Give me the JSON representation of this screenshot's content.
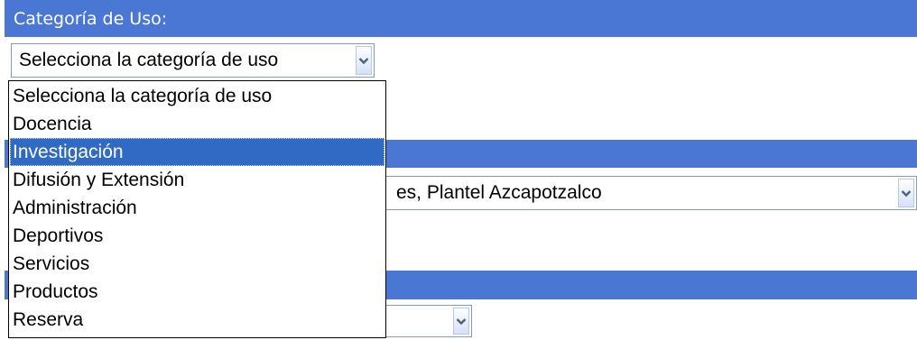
{
  "category_section": {
    "header_label": "Categoría de Uso:",
    "select": {
      "selected_value": "Selecciona la categoría de uso",
      "options": [
        {
          "label": "Selecciona la categoría de uso",
          "selected": false
        },
        {
          "label": "Docencia",
          "selected": false
        },
        {
          "label": "Investigación",
          "selected": true
        },
        {
          "label": "Difusión y Extensión",
          "selected": false
        },
        {
          "label": "Administración",
          "selected": false
        },
        {
          "label": "Deportivos",
          "selected": false
        },
        {
          "label": "Servicios",
          "selected": false
        },
        {
          "label": "Productos",
          "selected": false
        },
        {
          "label": "Reserva",
          "selected": false
        }
      ]
    }
  },
  "location_section": {
    "header_label": "",
    "select_visible_value": "es, Plantel Azcapotzalco"
  },
  "third_section": {
    "header_label": "",
    "select_visible_value": ""
  },
  "icons": {
    "dropdown_arrow": "chevron-down-icon"
  },
  "colors": {
    "header_bar": "#4a77d4",
    "highlight": "#316ac5",
    "arrow_glyph": "#4d6185"
  }
}
